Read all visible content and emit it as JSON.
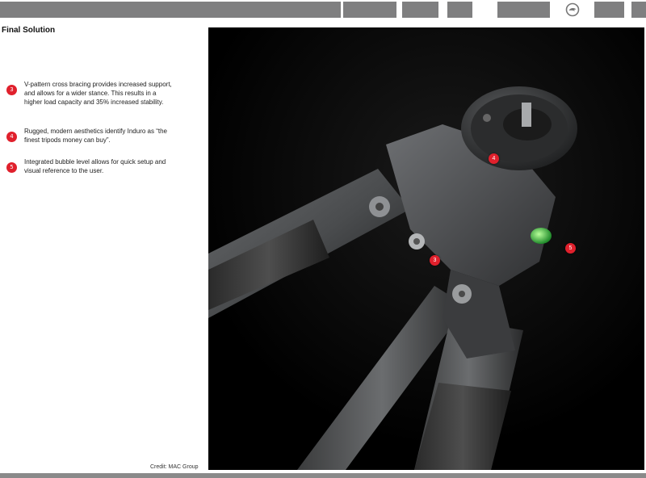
{
  "nav": {
    "logo_icon": "brand-logo-icon"
  },
  "page": {
    "title": "Final Solution",
    "credit": "Credit: MAC Group"
  },
  "features": [
    {
      "number": "3",
      "text": "V-pattern cross bracing provides increased support, and allows for a wider stance. This results in a higher load capacity and 35% increased stability."
    },
    {
      "number": "4",
      "text": "Rugged, modern aesthetics identify Induro as “the finest tripods money can buy”."
    },
    {
      "number": "5",
      "text": "Integrated bubble level allows for quick setup and visual reference to the user."
    }
  ],
  "photo": {
    "markers": [
      "4",
      "3",
      "5"
    ]
  },
  "colors": {
    "nav_gray": "#7f7f80",
    "marker_red": "#e0202c",
    "photo_bg": "#000000"
  }
}
